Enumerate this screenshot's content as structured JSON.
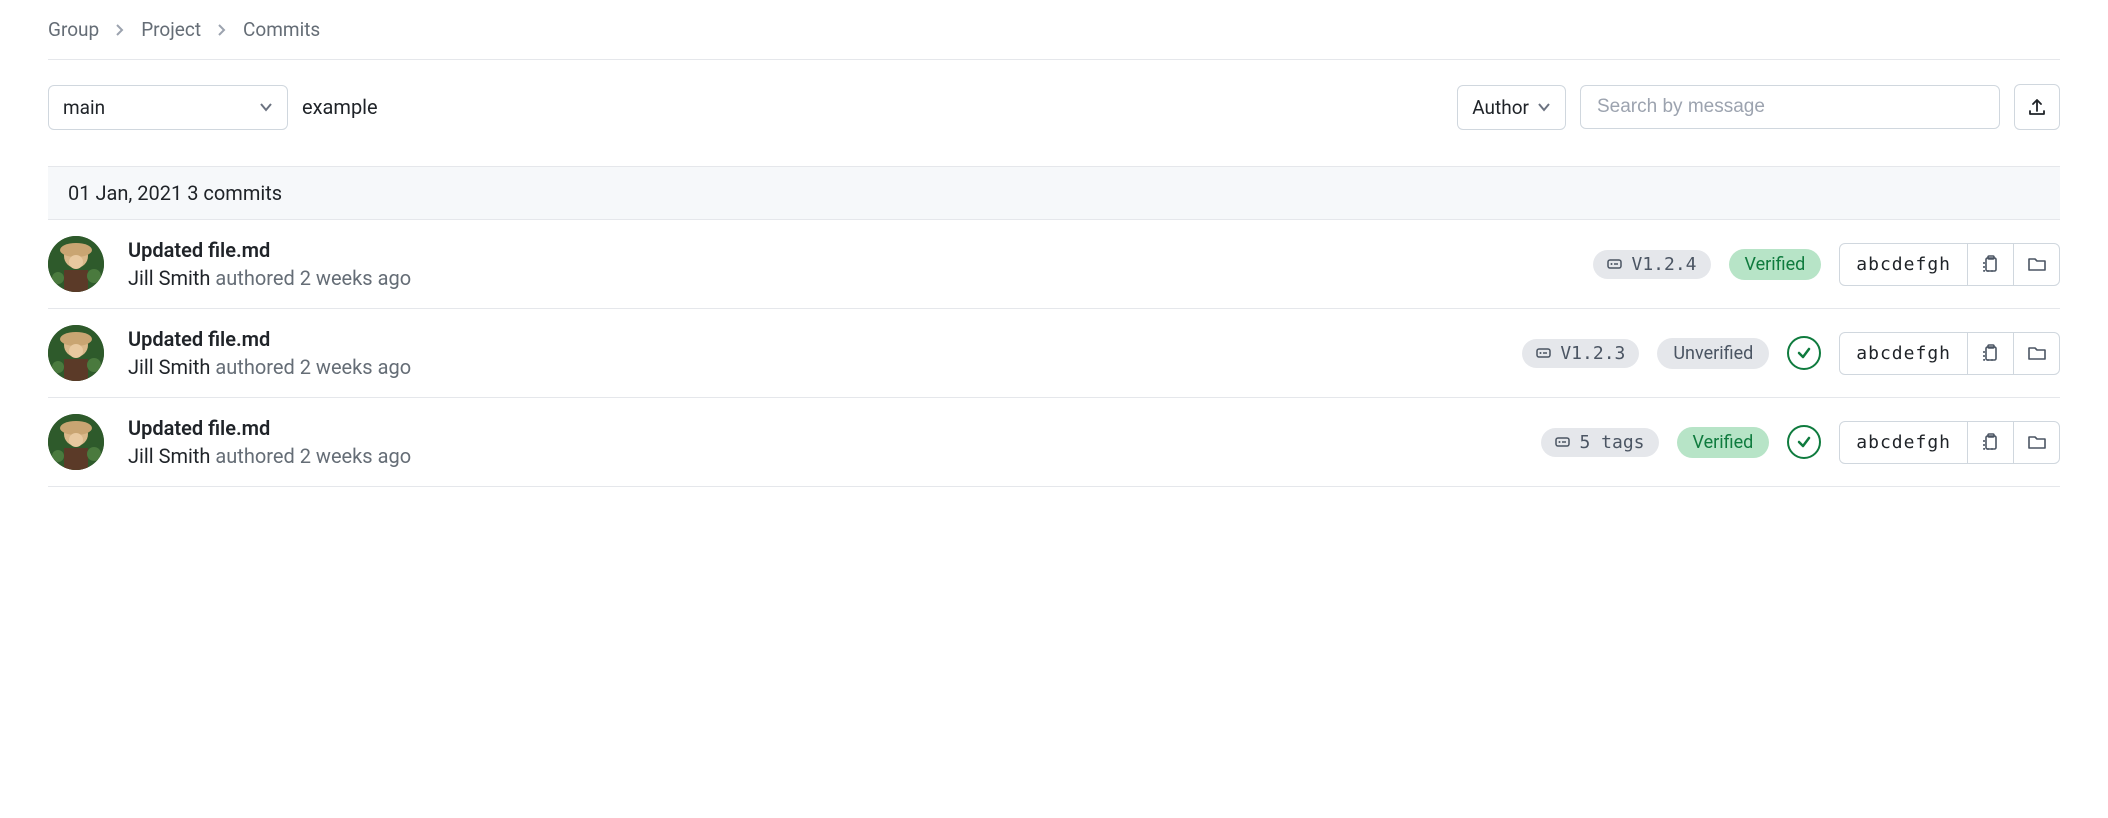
{
  "breadcrumb": {
    "group": "Group",
    "project": "Project",
    "commits": "Commits"
  },
  "toolbar": {
    "branch": "main",
    "path": "example",
    "author_label": "Author",
    "search_placeholder": "Search by message"
  },
  "date_group": {
    "date": "01 Jan, 2021",
    "count_text": "3 commits"
  },
  "commits": [
    {
      "title": "Updated file.md",
      "author": "Jill Smith",
      "action": "authored",
      "time": "2 weeks ago",
      "tag": "V1.2.4",
      "verify": "Verified",
      "verify_state": "verified",
      "has_status": false,
      "sha": "abcdefgh"
    },
    {
      "title": "Updated file.md",
      "author": "Jill Smith",
      "action": "authored",
      "time": "2 weeks ago",
      "tag": "V1.2.3",
      "verify": "Unverified",
      "verify_state": "unverified",
      "has_status": true,
      "sha": "abcdefgh"
    },
    {
      "title": "Updated file.md",
      "author": "Jill Smith",
      "action": "authored",
      "time": "2 weeks ago",
      "tag": "5 tags",
      "verify": "Verified",
      "verify_state": "verified",
      "has_status": true,
      "sha": "abcdefgh"
    }
  ]
}
